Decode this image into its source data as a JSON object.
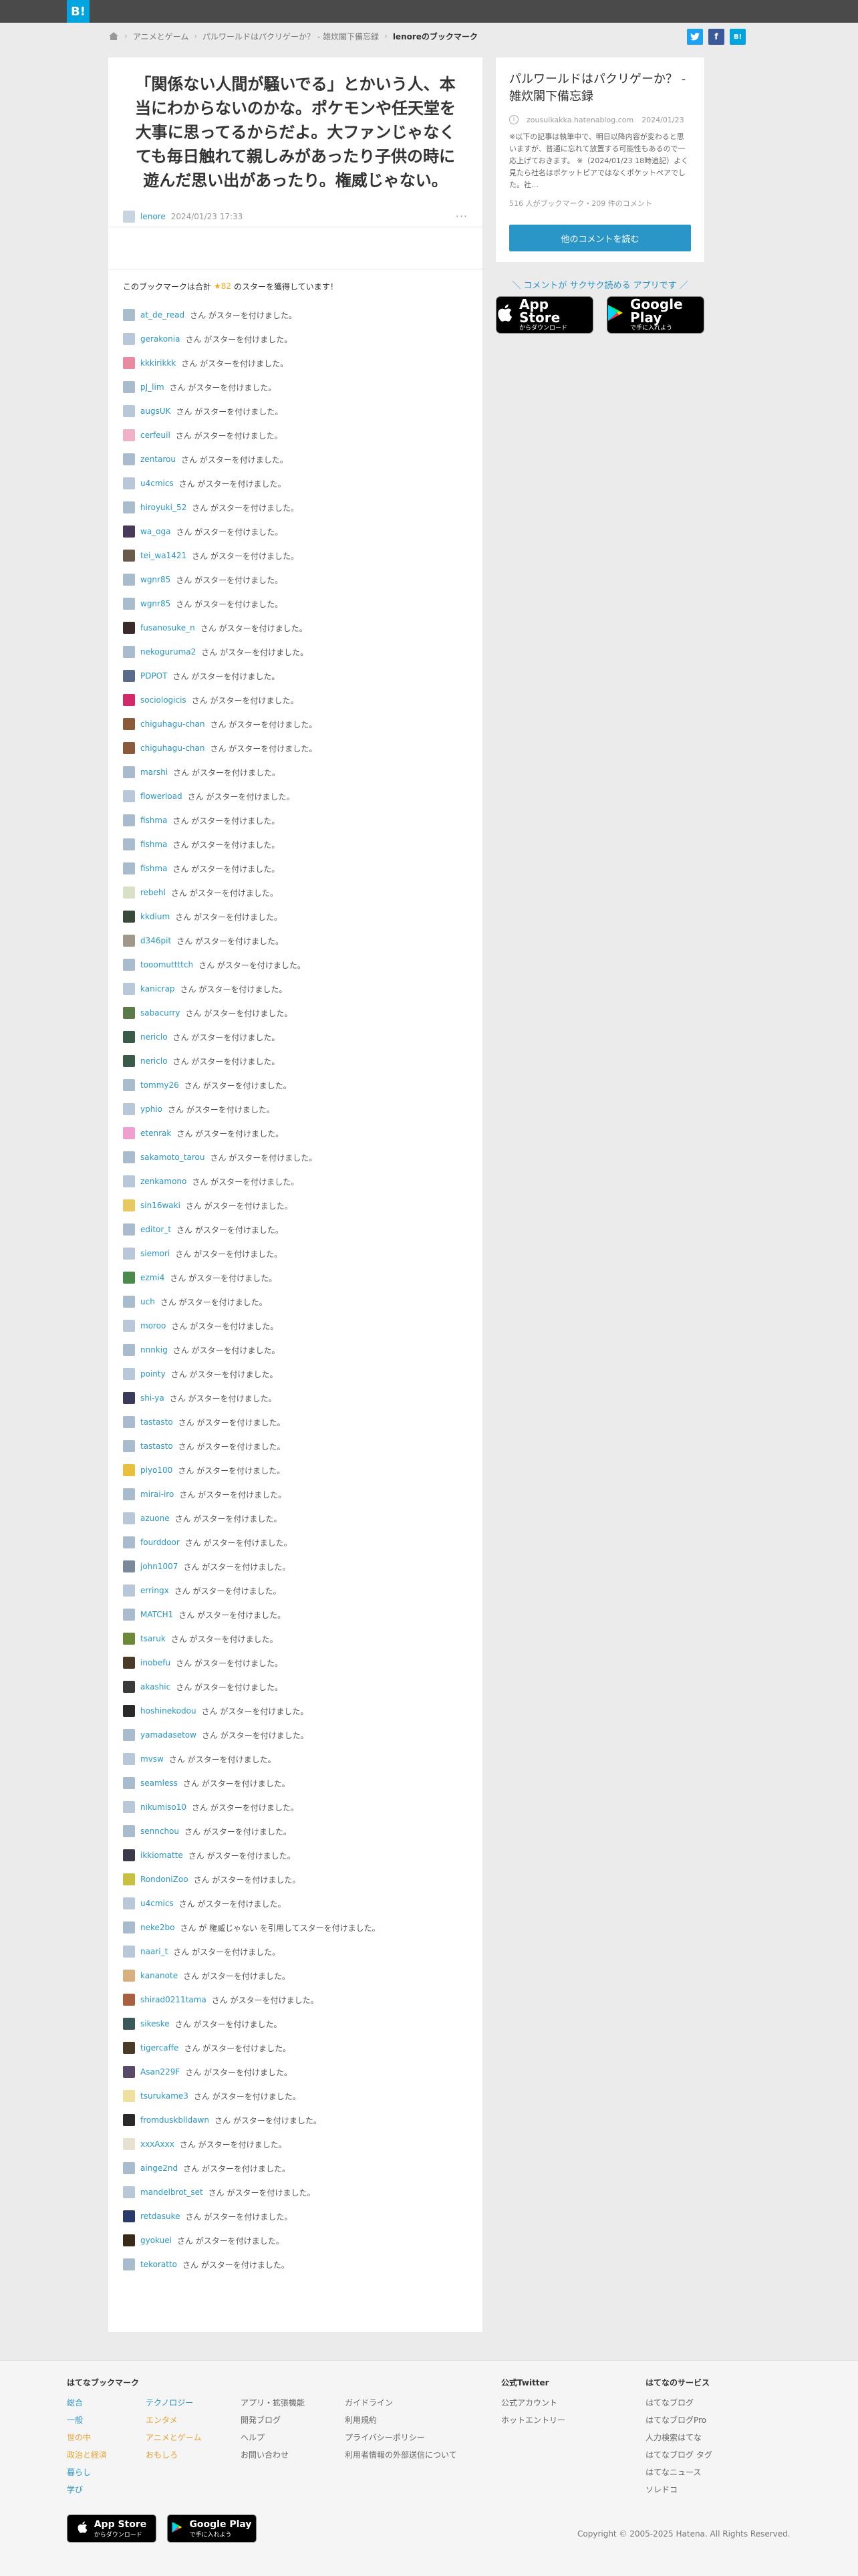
{
  "header": {
    "logo": "B!",
    "breadcrumb": [
      "アニメとゲーム",
      "パルワールドはパクリゲーか？ - 雑炊閣下備忘録",
      "lenoreのブックマーク"
    ]
  },
  "comment": {
    "text": "「関係ない人間が騒いでる」とかいう人、本当にわからないのかな。ポケモンや任天堂を大事に思ってるからだよ。大ファンじゃなくても毎日触れて親しみがあったり子供の時に遊んだ思い出があったり。権威じゃない。",
    "user": "lenore",
    "date": "2024/01/23 17:33",
    "menu": "···"
  },
  "stars": {
    "header_pre": "このブックマークは合計",
    "count": "★82",
    "header_post": "のスターを獲得しています！",
    "suffix": "さん がスターを付けました。",
    "items": [
      {
        "name": "at_de_read",
        "color": "#a8bccd"
      },
      {
        "name": "gerakonia",
        "color": "#b8c8d8"
      },
      {
        "name": "kkkirikkk",
        "color": "#e88aa0"
      },
      {
        "name": "pJ_lim",
        "color": "#a8bccd"
      },
      {
        "name": "augsUK",
        "color": "#b8c8d8"
      },
      {
        "name": "cerfeuil",
        "color": "#f0b0c8"
      },
      {
        "name": "zentarou",
        "color": "#a8bccd"
      },
      {
        "name": "u4cmics",
        "color": "#b8c8d8"
      },
      {
        "name": "hiroyuki_52",
        "color": "#a8bccd"
      },
      {
        "name": "wa_oga",
        "color": "#4a3a5a"
      },
      {
        "name": "tei_wa1421",
        "color": "#6a5a4a"
      },
      {
        "name": "wgnr85",
        "color": "#a8bccd"
      },
      {
        "name": "wgnr85",
        "color": "#a8bccd"
      },
      {
        "name": "fusanosuke_n",
        "color": "#3a2a2a"
      },
      {
        "name": "nekoguruma2",
        "color": "#a8bccd"
      },
      {
        "name": "PDPOT",
        "color": "#5a6a8a"
      },
      {
        "name": "sociologicis",
        "color": "#d02a6a"
      },
      {
        "name": "chiguhagu-chan",
        "color": "#8a5a3a"
      },
      {
        "name": "chiguhagu-chan",
        "color": "#8a5a3a"
      },
      {
        "name": "marshi",
        "color": "#a8bccd"
      },
      {
        "name": "flowerload",
        "color": "#b8c8d8"
      },
      {
        "name": "fishma",
        "color": "#a8bccd"
      },
      {
        "name": "fishma",
        "color": "#a8bccd"
      },
      {
        "name": "fishma",
        "color": "#a8bccd"
      },
      {
        "name": "rebehl",
        "color": "#d8e0c8"
      },
      {
        "name": "kkdium",
        "color": "#3a4a3a"
      },
      {
        "name": "d346pit",
        "color": "#a09888"
      },
      {
        "name": "tooomuttttch",
        "color": "#a8bccd"
      },
      {
        "name": "kanicrap",
        "color": "#b8c8d8"
      },
      {
        "name": "sabacurry",
        "color": "#5a7a4a"
      },
      {
        "name": "nericlo",
        "color": "#3a5a4a"
      },
      {
        "name": "nericlo",
        "color": "#3a5a4a"
      },
      {
        "name": "tommy26",
        "color": "#a8bccd"
      },
      {
        "name": "yphio",
        "color": "#b8c8d8"
      },
      {
        "name": "etenrak",
        "color": "#f0a0d0"
      },
      {
        "name": "sakamoto_tarou",
        "color": "#a8bccd"
      },
      {
        "name": "zenkamono",
        "color": "#b8c8d8"
      },
      {
        "name": "sin16waki",
        "color": "#e8c860"
      },
      {
        "name": "editor_t",
        "color": "#a8bccd"
      },
      {
        "name": "siemori",
        "color": "#b8c8d8"
      },
      {
        "name": "ezmi4",
        "color": "#4a8a4a"
      },
      {
        "name": "uch",
        "color": "#a8bccd"
      },
      {
        "name": "moroo",
        "color": "#b8c8d8"
      },
      {
        "name": "nnnkig",
        "color": "#a8bccd"
      },
      {
        "name": "pointy",
        "color": "#b8c8d8"
      },
      {
        "name": "shi-ya",
        "color": "#3a3a5a"
      },
      {
        "name": "tastasto",
        "color": "#a8bccd"
      },
      {
        "name": "tastasto",
        "color": "#a8bccd"
      },
      {
        "name": "piyo100",
        "color": "#e8c040"
      },
      {
        "name": "mirai-iro",
        "color": "#a8bccd"
      },
      {
        "name": "azuone",
        "color": "#b8c8d8"
      },
      {
        "name": "fourddoor",
        "color": "#a8bccd"
      },
      {
        "name": "john1007",
        "color": "#7a8a9a"
      },
      {
        "name": "erringx",
        "color": "#b8c8d8"
      },
      {
        "name": "MATCH1",
        "color": "#a8bccd"
      },
      {
        "name": "tsaruk",
        "color": "#6a8a3a"
      },
      {
        "name": "inobefu",
        "color": "#4a3a2a"
      },
      {
        "name": "akashic",
        "color": "#3a3a3a"
      },
      {
        "name": "hoshinekodou",
        "color": "#2a2a2a"
      },
      {
        "name": "yamadasetow",
        "color": "#a8bccd"
      },
      {
        "name": "mvsw",
        "color": "#b8c8d8"
      },
      {
        "name": "seamless",
        "color": "#a8bccd"
      },
      {
        "name": "nikumiso10",
        "color": "#b8c8d8"
      },
      {
        "name": "sennchou",
        "color": "#a8bccd"
      },
      {
        "name": "ikkiomatte",
        "color": "#3a3a4a"
      },
      {
        "name": "RondoniZoo",
        "color": "#c8c040"
      },
      {
        "name": "u4cmics",
        "color": "#b8c8d8"
      },
      {
        "name": "neke2bo",
        "color": "#a8bccd"
      },
      {
        "name": "naari_t",
        "color": "#b8c8d8"
      },
      {
        "name": "kananote",
        "color": "#d8b080"
      },
      {
        "name": "shirad0211tama",
        "color": "#a86040"
      },
      {
        "name": "sikeske",
        "color": "#3a5a5a"
      },
      {
        "name": "tigercaffe",
        "color": "#4a3a2a"
      },
      {
        "name": "Asan229F",
        "color": "#5a4a6a"
      },
      {
        "name": "tsurukame3",
        "color": "#f0e0a0"
      },
      {
        "name": "fromduskblldawn",
        "color": "#2a2a2a"
      },
      {
        "name": "xxxAxxx",
        "color": "#e8e0d0"
      },
      {
        "name": "ainge2nd",
        "color": "#a8bccd"
      },
      {
        "name": "mandelbrot_set",
        "color": "#b8c8d8"
      },
      {
        "name": "retdasuke",
        "color": "#2a3a6a"
      },
      {
        "name": "gyokuei",
        "color": "#3a2a1a"
      },
      {
        "name": "tekoratto",
        "color": "#a8bccd"
      }
    ],
    "quote_item": {
      "index": 67,
      "text": "さん が 権威じゃない を引用してスターを付けました。"
    }
  },
  "entry": {
    "title": "パルワールドはパクリゲーか？ - 雑炊閣下備忘録",
    "domain": "zousuikakka.hatenablog.com",
    "date": "2024/01/23",
    "description": "※以下の記事は執筆中で、明日以降内容が変わると思いますが、普通に忘れて放置する可能性もあるので一応上げておきます。 ※（2024/01/23 18時追記）よく見たら社名はポケットピアではなくポケットペアでした。社…",
    "counts": "516 人がブックマーク・209 件のコメント",
    "more_button": "他のコメントを読む"
  },
  "app": {
    "promo": "＼ コメントが サクサク読める アプリです ／",
    "appstore_small": "からダウンロード",
    "appstore_big": "App Store",
    "play_small": "で手に入れよう",
    "play_big": "Google Play"
  },
  "footer": {
    "col1_title": "はてなブックマーク",
    "col1a": [
      "総合",
      "一般",
      "世の中",
      "政治と経済",
      "暮らし",
      "学び"
    ],
    "col1b": [
      "テクノロジー",
      "エンタメ",
      "アニメとゲーム",
      "おもしろ"
    ],
    "col1c": [
      "アプリ・拡張機能",
      "開発ブログ",
      "ヘルプ",
      "お問い合わせ"
    ],
    "col1d": [
      "ガイドライン",
      "利用規約",
      "プライバシーポリシー",
      "利用者情報の外部送信について"
    ],
    "col2_title": "公式Twitter",
    "col2": [
      "公式アカウント",
      "ホットエントリー"
    ],
    "col3_title": "はてなのサービス",
    "col3": [
      "はてなブログ",
      "はてなブログPro",
      "人力検索はてな",
      "はてなブログ タグ",
      "はてなニュース",
      "ソレドコ"
    ],
    "copyright": "Copyright © 2005-2025 Hatena. All Rights Reserved."
  }
}
